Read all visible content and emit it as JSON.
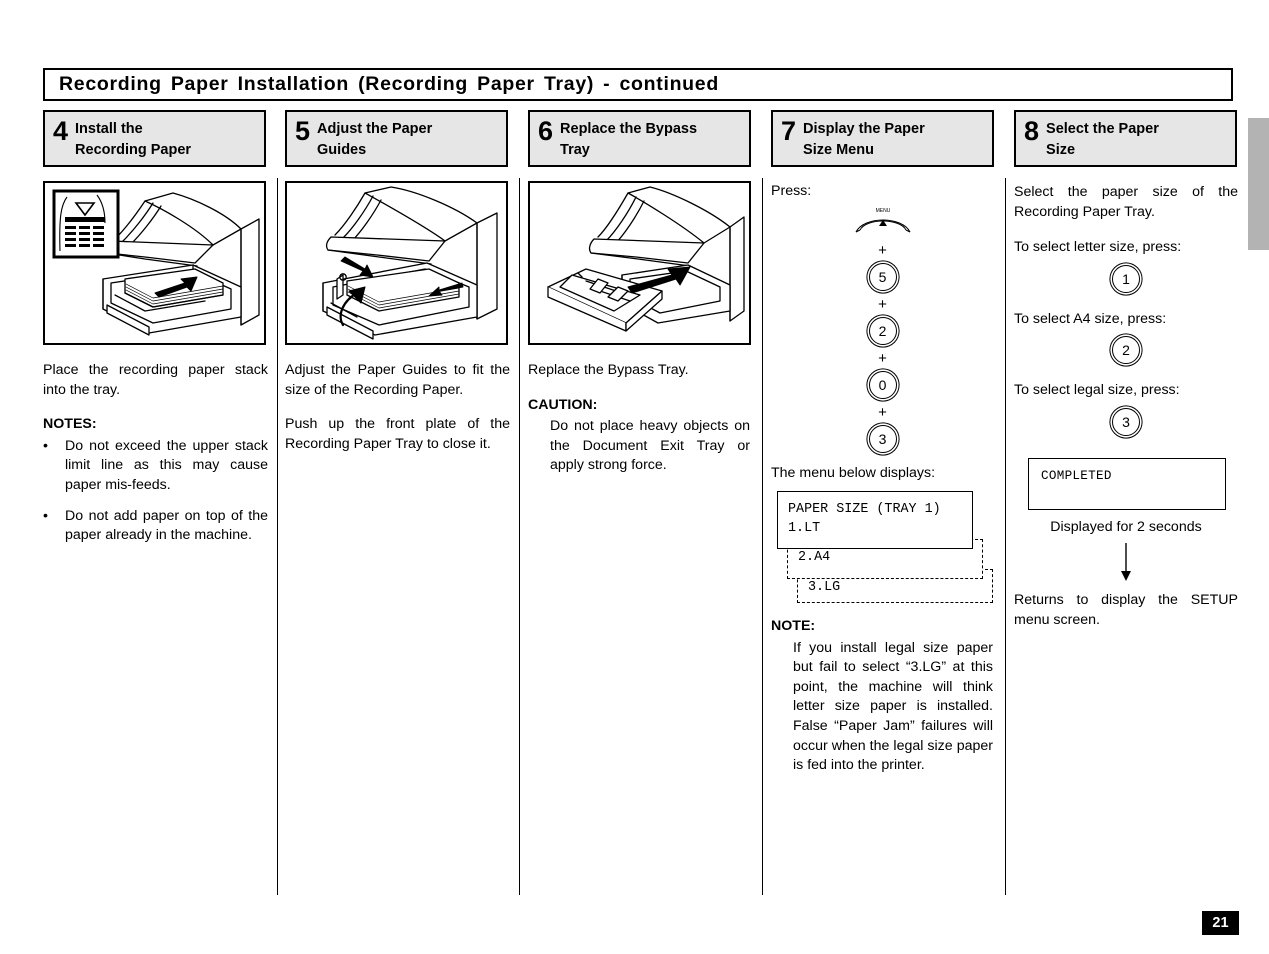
{
  "document": {
    "header_title": "Recording Paper Installation (Recording Paper Tray) - continued",
    "page_number": "21"
  },
  "steps": [
    {
      "number": "4",
      "title_line1": "Install the",
      "title_line2": "Recording Paper",
      "illustration": "printer-tray-insert-paper-with-stack-limit-inset",
      "body": {
        "intro": "Place the recording paper stack into the tray.",
        "notes_heading": "NOTES:",
        "bullets": [
          "Do not exceed the upper stack limit line as this may cause paper mis-feeds.",
          "Do not add paper on top of the paper already in the machine."
        ]
      }
    },
    {
      "number": "5",
      "title_line1": "Adjust the Paper",
      "title_line2": "Guides",
      "illustration": "printer-tray-adjust-paper-guides-arrows",
      "body": {
        "para1": "Adjust the Paper Guides to fit the size of the Recording Paper.",
        "para2": "Push up the front plate of the Recording Paper Tray to close it."
      }
    },
    {
      "number": "6",
      "title_line1": "Replace the Bypass",
      "title_line2": "Tray",
      "illustration": "printer-replace-bypass-tray-arrow",
      "body": {
        "para1": "Replace the Bypass Tray.",
        "caution_heading": "CAUTION:",
        "caution_text": "Do not place heavy objects on the Document Exit Tray or apply strong force."
      }
    },
    {
      "number": "7",
      "title_line1": "Display the Paper",
      "title_line2": "Size Menu",
      "body": {
        "press_label": "Press:",
        "menu_key_label": "MENU",
        "key_sequence": [
          "MENU",
          "+",
          "5",
          "+",
          "2",
          "+",
          "0",
          "+",
          "3"
        ],
        "keys": [
          "5",
          "2",
          "0",
          "3"
        ],
        "plus_symbol": "+",
        "menu_below_label": "The menu below displays:",
        "lcd_main_line1": "PAPER SIZE (TRAY 1)",
        "lcd_main_line2": "1.LT",
        "lcd_option_a4": "2.A4",
        "lcd_option_lg": "3.LG",
        "note_heading": "NOTE:",
        "note_text": "If you install legal size paper but fail to select “3.LG” at this point, the machine will think letter size paper is installed. False “Paper Jam” failures will occur when the legal size paper is fed into the printer."
      }
    },
    {
      "number": "8",
      "title_line1": "Select the Paper",
      "title_line2": "Size",
      "body": {
        "intro": "Select the paper size of the Recording Paper Tray.",
        "letter_prompt": "To select letter size, press:",
        "letter_key": "1",
        "a4_prompt": "To select A4 size, press:",
        "a4_key": "2",
        "legal_prompt": "To select legal size, press:",
        "legal_key": "3",
        "completed_lcd": "COMPLETED",
        "displayed_caption": "Displayed for 2 seconds",
        "returns_text": "Returns to display the SETUP menu screen."
      }
    }
  ],
  "colors": {
    "step_header_bg": "#e6e6e6",
    "edge_tab": "#b3b3b3",
    "rule": "#000000",
    "page_badge_bg": "#000000"
  }
}
